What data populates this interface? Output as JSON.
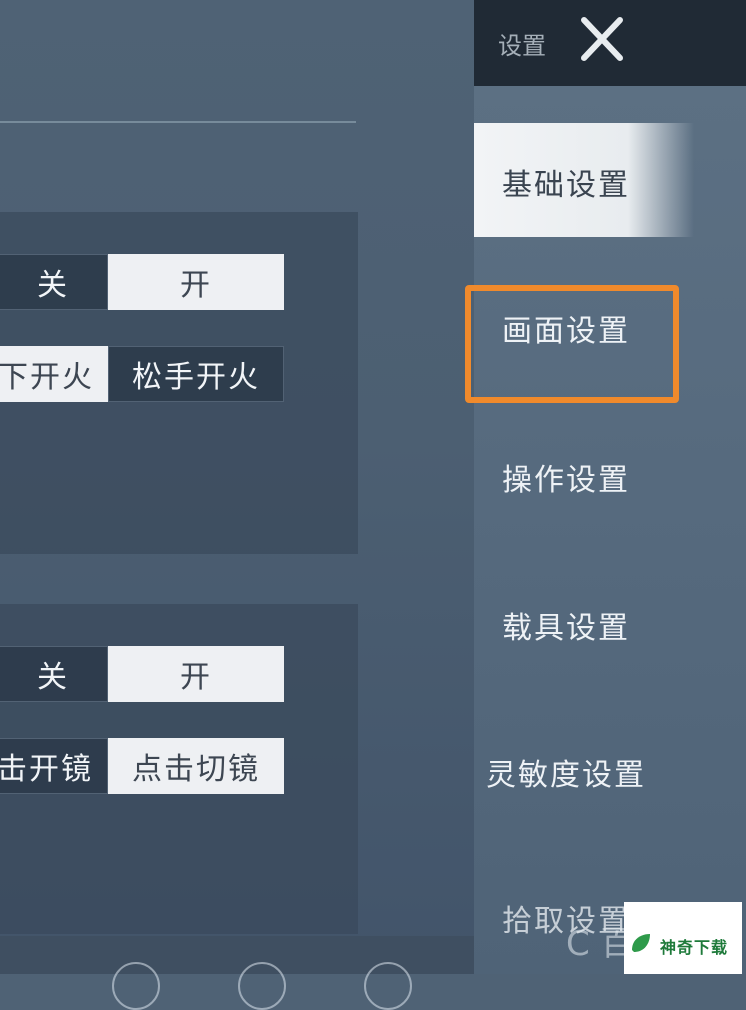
{
  "sidebar": {
    "title": "设置",
    "items": [
      {
        "label": "基础设置",
        "active": true
      },
      {
        "label": "画面设置"
      },
      {
        "label": "操作设置"
      },
      {
        "label": "载具设置"
      },
      {
        "label": "灵敏度设置"
      },
      {
        "label": "拾取设置"
      }
    ]
  },
  "panel_a": {
    "row1": {
      "off": "关",
      "on": "开",
      "selected": "开"
    },
    "row2": {
      "option1": "下开火",
      "option2": "松手开火",
      "selected": "下开火"
    }
  },
  "panel_b": {
    "row1": {
      "off": "关",
      "on": "开",
      "selected": "开"
    },
    "row2": {
      "option1": "击开镜",
      "option2": "点击切镜",
      "selected": "点击切镜"
    }
  },
  "watermark": {
    "text": "神奇下载",
    "ghost": "C 百"
  },
  "colors": {
    "highlight": "#f08a2c",
    "selected_bg": "#eef0f3",
    "sidebar_bg": "#566a7e"
  }
}
